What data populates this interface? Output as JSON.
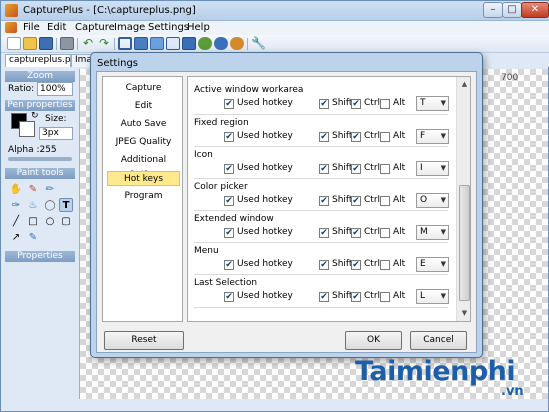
{
  "window": {
    "title": "CapturePlus - [C:\\captureplus.png]"
  },
  "menu": [
    "File",
    "Edit",
    "Capture",
    "Image",
    "Settings",
    "Help"
  ],
  "tabs": {
    "active": "captureplus.png",
    "second": "Imag"
  },
  "left_panel": {
    "zoom_header": "Zoom",
    "ratio_label": "Ratio:",
    "ratio_value": "100%",
    "pen_header": "Pen properties",
    "size_label": "Size:",
    "size_value": "3px",
    "alpha_label": "Alpha :255",
    "paint_header": "Paint tools",
    "properties_header": "Properties"
  },
  "ruler": {
    "top_value": "700"
  },
  "dialog": {
    "title": "Settings",
    "categories": [
      "Capture",
      "Edit",
      "Auto Save",
      "JPEG Quality",
      "Additional Option",
      "Hot keys",
      "Program"
    ],
    "active_category": "Hot keys",
    "hotkey_groups": [
      {
        "title": "Active window workarea",
        "used_label": "Used hotkey",
        "shift_label": "Shift",
        "ctrl_label": "Ctrl",
        "alt_label": "Alt",
        "key": "T"
      },
      {
        "title": "Fixed region",
        "used_label": "Used hotkey",
        "shift_label": "Shift",
        "ctrl_label": "Ctrl",
        "alt_label": "Alt",
        "key": "F"
      },
      {
        "title": "Icon",
        "used_label": "Used hotkey",
        "shift_label": "Shift",
        "ctrl_label": "Ctrl",
        "alt_label": "Alt",
        "key": "I"
      },
      {
        "title": "Color picker",
        "used_label": "Used hotkey",
        "shift_label": "Shift",
        "ctrl_label": "Ctrl",
        "alt_label": "Alt",
        "key": "O"
      },
      {
        "title": "Extended window",
        "used_label": "Used hotkey",
        "shift_label": "Shift",
        "ctrl_label": "Ctrl",
        "alt_label": "Alt",
        "key": "M"
      },
      {
        "title": "Menu",
        "used_label": "Used hotkey",
        "shift_label": "Shift",
        "ctrl_label": "Ctrl",
        "alt_label": "Alt",
        "key": "E"
      },
      {
        "title": "Last Selection",
        "used_label": "Used hotkey",
        "shift_label": "Shift",
        "ctrl_label": "Ctrl",
        "alt_label": "Alt",
        "key": "L"
      }
    ],
    "reset_label": "Reset",
    "ok_label": "OK",
    "cancel_label": "Cancel"
  },
  "watermark": {
    "text": "Taimienphi",
    "suffix": ".vn"
  },
  "colors": {
    "accent": "#1c5ea8",
    "highlight": "#ffe98c"
  }
}
